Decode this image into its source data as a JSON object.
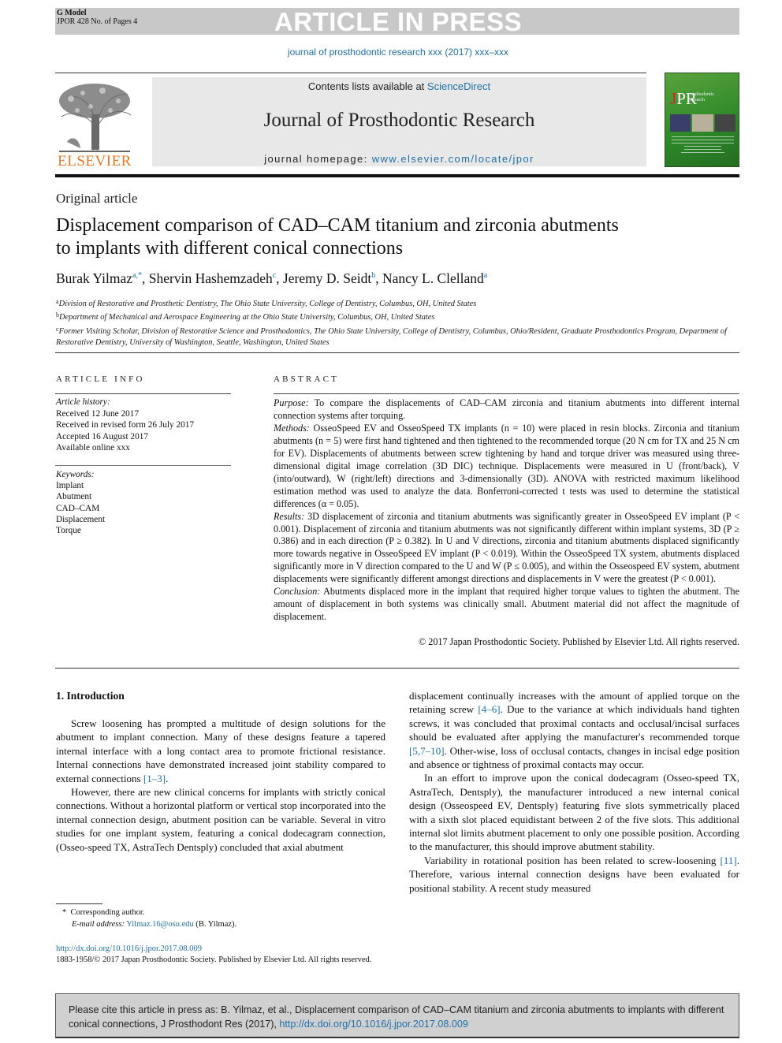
{
  "banner": {
    "model_label": "G Model",
    "model_ref": "JPOR 428 No. of Pages 4",
    "status": "ARTICLE IN PRESS"
  },
  "running_ref": "journal of prosthodontic research xxx (2017) xxx–xxx",
  "header": {
    "publisher_logo_text": "ELSEVIER",
    "contents_prefix": "Contents lists available at ",
    "contents_link": "ScienceDirect",
    "journal_title": "Journal of Prosthodontic Research",
    "homepage_prefix": "journal homepage: ",
    "homepage_link": "www.elsevier.com/locate/jpor",
    "cover": {
      "initials_j": "J",
      "initials_pr": "PR",
      "small_text": "rosthodontic\nesearch"
    }
  },
  "colors": {
    "link": "#1f6fa8",
    "elsevier_orange": "#e87722",
    "banner_gray": "#c8c8c8",
    "cover_green": "#2f8a2a"
  },
  "article": {
    "type": "Original article",
    "title": "Displacement comparison of CAD–CAM titanium and zirconia abutments to implants with different conical connections",
    "authors": [
      {
        "name": "Burak Yilmaz",
        "sup": "a,*"
      },
      {
        "name": "Shervin Hashemzadeh",
        "sup": "c"
      },
      {
        "name": "Jeremy D. Seidt",
        "sup": "b"
      },
      {
        "name": "Nancy L. Clelland",
        "sup": "a"
      }
    ],
    "affiliations": [
      {
        "sup": "a",
        "text": "Division of Restorative and Prosthetic Dentistry, The Ohio State University, College of Dentistry, Columbus, OH, United States"
      },
      {
        "sup": "b",
        "text": "Department of Mechanical and Aerospace Engineering at the Ohio State University, Columbus, OH, United States"
      },
      {
        "sup": "c",
        "text": "Former Visiting Scholar, Division of Restorative Science and Prosthodontics, The Ohio State University, College of Dentistry, Columbus, Ohio/Resident, Graduate Prosthodontics Program, Department of Restorative Dentistry, University of Washington, Seattle, Washington, United States"
      }
    ]
  },
  "article_info": {
    "heading": "ARTICLE INFO",
    "history_label": "Article history:",
    "history": [
      "Received 12 June 2017",
      "Received in revised form 26 July 2017",
      "Accepted 16 August 2017",
      "Available online xxx"
    ],
    "keywords_label": "Keywords:",
    "keywords": [
      "Implant",
      "Abutment",
      "CAD–CAM",
      "Displacement",
      "Torque"
    ]
  },
  "abstract": {
    "heading": "ABSTRACT",
    "sections": [
      {
        "label": "Purpose:",
        "text": " To compare the displacements of CAD–CAM zirconia and titanium abutments into different internal connection systems after torquing."
      },
      {
        "label": "Methods:",
        "text": " OsseoSpeed EV and OsseoSpeed TX implants (n = 10) were placed in resin blocks. Zirconia and titanium abutments (n = 5) were first hand tightened and then tightened to the recommended torque (20 N cm for TX and 25 N cm for EV). Displacements of abutments between screw tightening by hand and torque driver was measured using three-dimensional digital image correlation (3D DIC) technique. Displacements were measured in U (front/back), V (into/outward), W (right/left) directions and 3-dimensionally (3D). ANOVA with restricted maximum likelihood estimation method was used to analyze the data. Bonferroni-corrected t tests was used to determine the statistical differences (α = 0.05)."
      },
      {
        "label": "Results:",
        "text": " 3D displacement of zirconia and titanium abutments was significantly greater in OsseoSpeed EV implant (P < 0.001). Displacement of zirconia and titanium abutments was not significantly different within implant systems, 3D (P ≥ 0.386) and in each direction (P ≥ 0.382). In U and V directions, zirconia and titanium abutments displaced significantly more towards negative in OsseoSpeed EV implant (P < 0.019). Within the OsseoSpeed TX system, abutments displaced significantly more in V direction compared to the U and W (P ≤ 0.005), and within the Osseospeed EV system, abutment displacements were significantly different amongst directions and displacements in V were the greatest (P < 0.001)."
      },
      {
        "label": "Conclusion:",
        "text": " Abutments displaced more in the implant that required higher torque values to tighten the abutment. The amount of displacement in both systems was clinically small. Abutment material did not affect the magnitude of displacement."
      }
    ],
    "copyright": "© 2017 Japan Prosthodontic Society. Published by Elsevier Ltd. All rights reserved."
  },
  "body": {
    "section_heading": "1. Introduction",
    "col1": [
      {
        "parts": [
          {
            "t": "Screw loosening has prompted a multitude of design solutions for the abutment to implant connection. Many of these designs feature a tapered internal interface with a long contact area to promote frictional resistance. Internal connections have demonstrated increased joint stability compared to external connections "
          },
          {
            "ref": "[1–3]"
          },
          {
            "t": "."
          }
        ]
      },
      {
        "parts": [
          {
            "t": "However, there are new clinical concerns for implants with strictly conical connections. Without a horizontal platform or vertical stop incorporated into the internal connection design, abutment position can be variable. Several in vitro studies for one implant system, featuring a conical dodecagram connection, (Osseo-speed TX, AstraTech Dentsply) concluded that axial abutment"
          }
        ]
      }
    ],
    "col2": [
      {
        "parts": [
          {
            "t": "displacement continually increases with the amount of applied torque on the retaining screw "
          },
          {
            "ref": "[4–6]"
          },
          {
            "t": ". Due to the variance at which individuals hand tighten screws, it was concluded that proximal contacts and occlusal/incisal surfaces should be evaluated after applying the manufacturer's recommended torque "
          },
          {
            "ref": "[5,7–10]"
          },
          {
            "t": ". Other-wise, loss of occlusal contacts, changes in incisal edge position and absence or tightness of proximal contacts may occur."
          }
        ]
      },
      {
        "parts": [
          {
            "t": "In an effort to improve upon the conical dodecagram (Osseo-speed TX, AstraTech, Dentsply), the manufacturer introduced a new internal conical design (Osseospeed EV, Dentsply) featuring five slots symmetrically placed with a sixth slot placed equidistant between 2 of the five slots. This additional internal slot limits abutment placement to only one possible position. According to the manufacturer, this should improve abutment stability."
          }
        ]
      },
      {
        "parts": [
          {
            "t": "Variability in rotational position has been related to screw-loosening "
          },
          {
            "ref": "[11]"
          },
          {
            "t": ". Therefore, various internal connection designs have been evaluated for positional stability. A recent study measured"
          }
        ]
      }
    ]
  },
  "footnote": {
    "marker": "*",
    "corresponding": "Corresponding author.",
    "email_label": "E-mail address:",
    "email": "Yilmaz.16@osu.edu",
    "email_suffix": " (B. Yilmaz)."
  },
  "doi": "http://dx.doi.org/10.1016/j.jpor.2017.08.009",
  "issn_line": "1883-1958/© 2017 Japan Prosthodontic Society. Published by Elsevier Ltd. All rights reserved.",
  "cite_box": {
    "text": "Please cite this article in press as: B. Yilmaz, et al., Displacement comparison of CAD–CAM titanium and zirconia abutments to implants with different conical connections, J Prosthodont Res (2017), ",
    "link": "http://dx.doi.org/10.1016/j.jpor.2017.08.009"
  }
}
